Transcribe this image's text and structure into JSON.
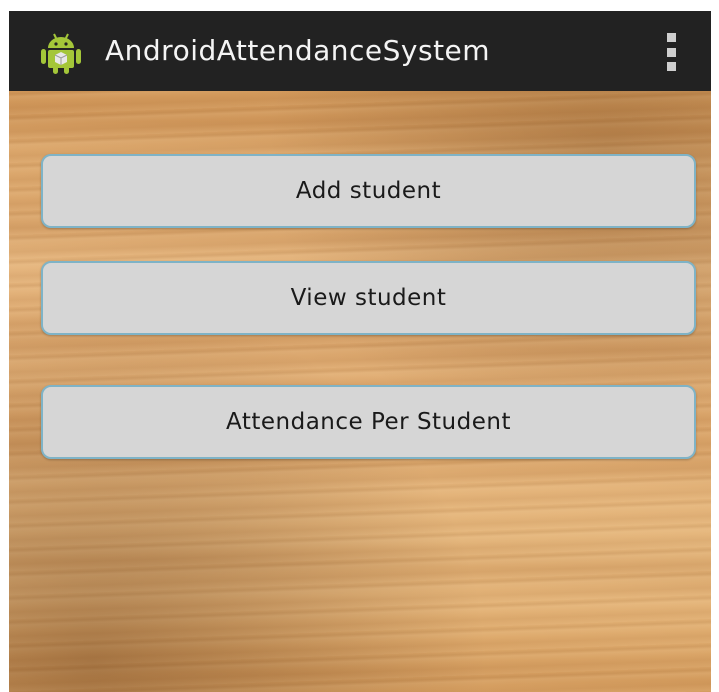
{
  "app": {
    "title": "AndroidAttendanceSystem",
    "icon": "android-robot-icon",
    "overflow_icon": "overflow-menu-icon"
  },
  "colors": {
    "action_bar": "#222222",
    "title_text": "#f4f4f4",
    "button_fill": "#d6d6d6",
    "button_border": "#7fb3c6",
    "android_green": "#a4c639"
  },
  "buttons": {
    "add_student": "Add student",
    "view_student": "View student",
    "attendance_per_student": "Attendance Per Student"
  }
}
